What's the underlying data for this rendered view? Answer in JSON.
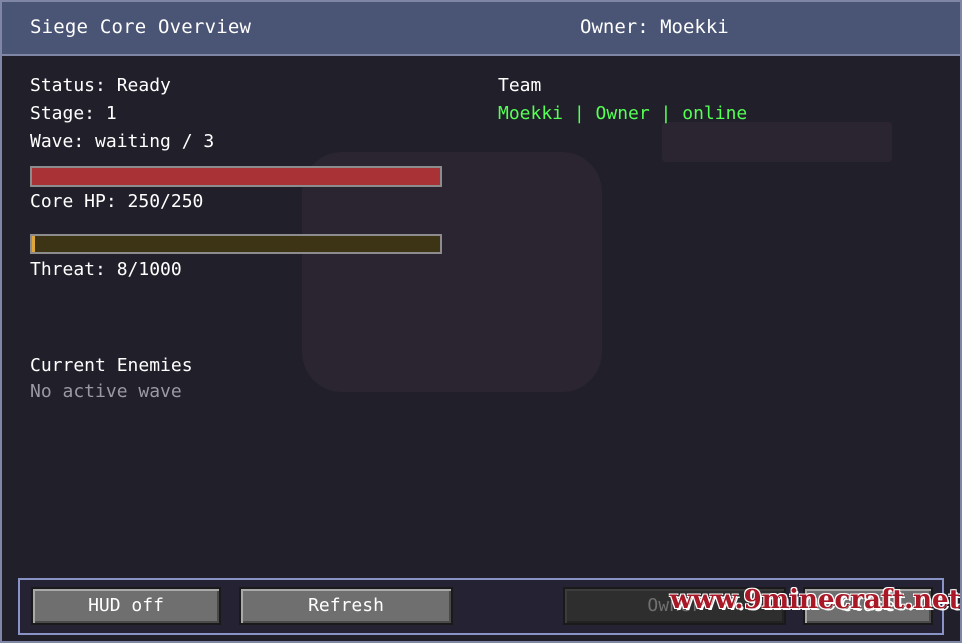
{
  "header": {
    "title": "Siege Core Overview",
    "owner": "Owner: Moekki"
  },
  "status": {
    "status_line": "Status: Ready",
    "stage_line": "Stage: 1",
    "wave_line": "Wave: waiting / 3"
  },
  "core_hp": {
    "label": "Core HP: 250/250",
    "fraction": 1.0
  },
  "threat": {
    "label": "Threat: 8/1000",
    "fraction": 0.008
  },
  "team": {
    "heading": "Team",
    "members": [
      "Moekki | Owner | online"
    ]
  },
  "enemies": {
    "heading": "Current Enemies",
    "empty_text": "No active wave"
  },
  "buttons": {
    "hud": "HUD off",
    "refresh": "Refresh",
    "owner": "Owner",
    "close": "Close"
  },
  "watermark": "www.9minecraft.net",
  "colors": {
    "header_bg": "#4a5474",
    "hp_fill": "#a83236",
    "threat_fill": "#e0a63a",
    "online_green": "#55ff55"
  }
}
